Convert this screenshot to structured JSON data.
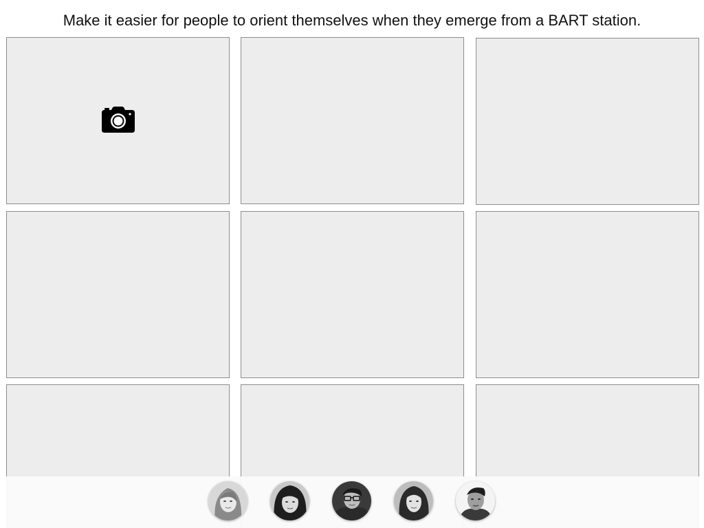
{
  "header": {
    "prompt": "Make it easier for people to orient themselves when they emerge from a BART station."
  },
  "grid": {
    "tile_fill": "#ededed",
    "tile_border": "#8c8c8c",
    "tiles": [
      {
        "icon": "camera-icon"
      },
      {
        "icon": null
      },
      {
        "icon": null
      },
      {
        "icon": null
      },
      {
        "icon": null
      },
      {
        "icon": null
      },
      {
        "icon": null
      },
      {
        "icon": null
      },
      {
        "icon": null
      }
    ]
  },
  "participants": {
    "avatars": [
      {
        "name": "participant-1"
      },
      {
        "name": "participant-2"
      },
      {
        "name": "participant-3"
      },
      {
        "name": "participant-4"
      },
      {
        "name": "participant-5"
      }
    ]
  }
}
